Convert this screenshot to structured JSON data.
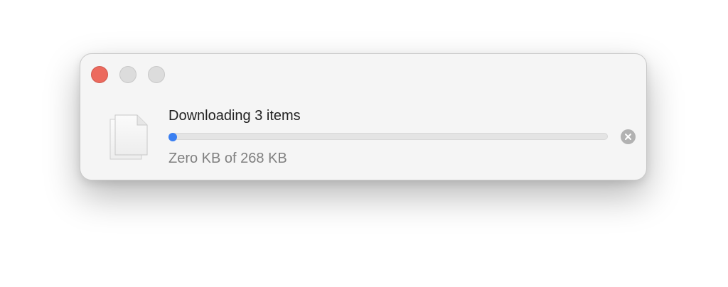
{
  "window": {
    "title_bar": {
      "close_color": "#ec6a5e",
      "minimize_color": "#dcdcdc",
      "zoom_color": "#dcdcdc"
    }
  },
  "download": {
    "icon": "document-stack-icon",
    "title": "Downloading 3 items",
    "progress_fraction": 0.0,
    "progress_color": "#3a7ff2",
    "status": "Zero KB of 268 KB",
    "cancel_icon": "close-circle-icon"
  }
}
